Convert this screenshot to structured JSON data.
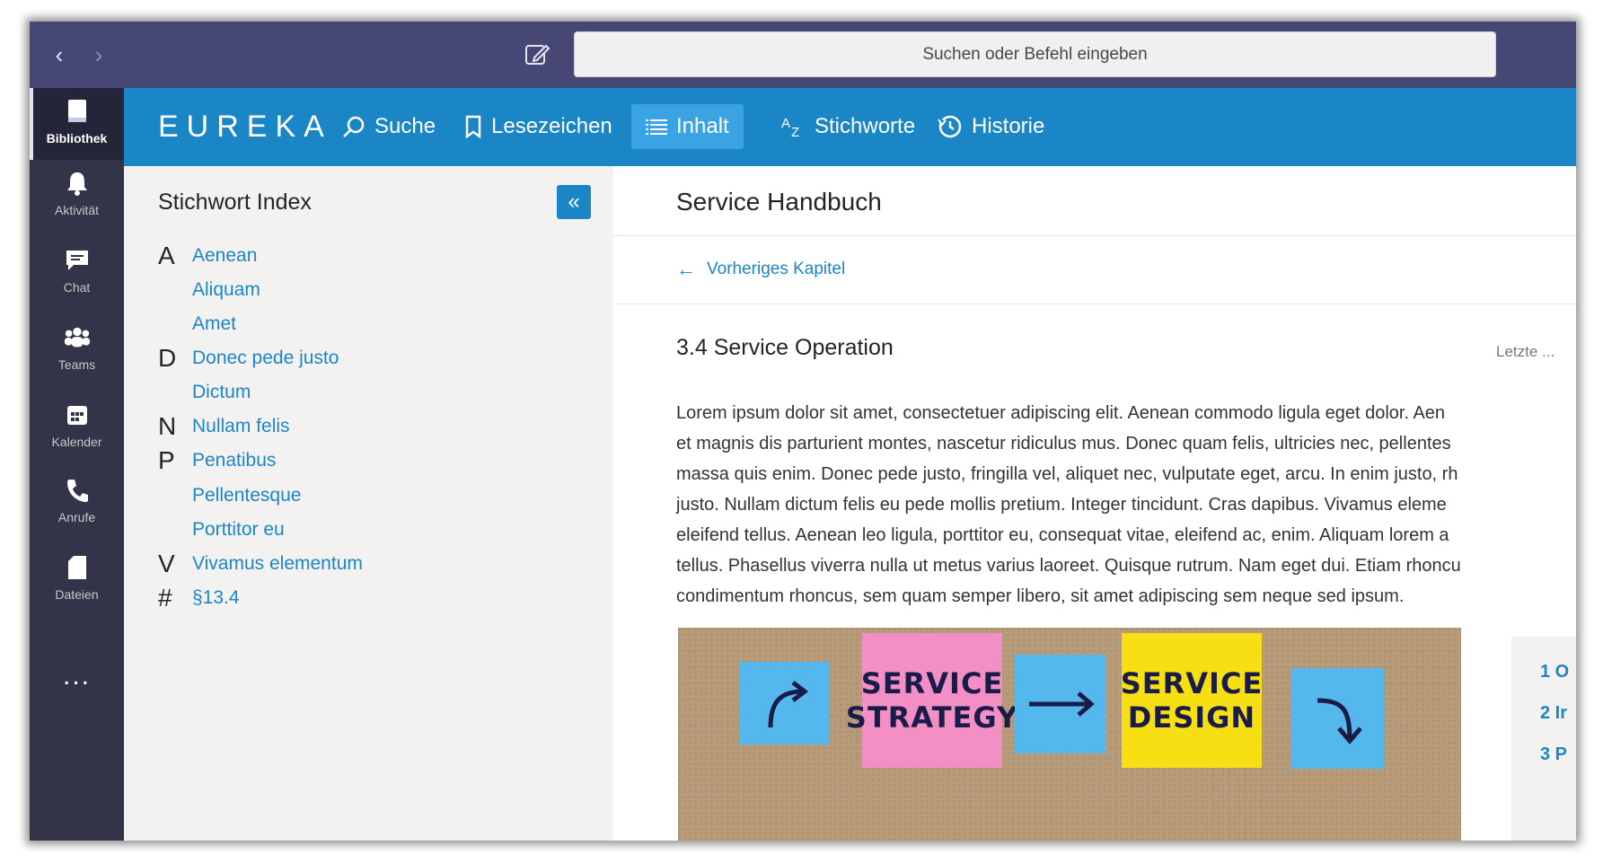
{
  "titlebar": {
    "search_placeholder": "Suchen oder Befehl eingeben"
  },
  "rail": {
    "items": [
      {
        "label": "Bibliothek",
        "icon": "library-icon",
        "active": true
      },
      {
        "label": "Aktivität",
        "icon": "bell-icon"
      },
      {
        "label": "Chat",
        "icon": "chat-icon"
      },
      {
        "label": "Teams",
        "icon": "teams-icon"
      },
      {
        "label": "Kalender",
        "icon": "calendar-icon"
      },
      {
        "label": "Anrufe",
        "icon": "phone-icon"
      },
      {
        "label": "Dateien",
        "icon": "file-icon"
      }
    ],
    "more": "..."
  },
  "appbar": {
    "logo": "EUREKA",
    "tabs": [
      {
        "label": "Suche",
        "icon": "search-icon"
      },
      {
        "label": "Lesezeichen",
        "icon": "bookmark-icon"
      },
      {
        "label": "Inhalt",
        "icon": "list-icon",
        "active": true
      },
      {
        "label": "Stichworte",
        "icon": "az-sort-icon"
      },
      {
        "label": "Historie",
        "icon": "history-icon"
      }
    ]
  },
  "index": {
    "title": "Stichwort Index",
    "collapse_symbol": "«",
    "entries": [
      {
        "letter": "A",
        "term": "Aenean"
      },
      {
        "letter": "",
        "term": "Aliquam"
      },
      {
        "letter": "",
        "term": "Amet"
      },
      {
        "letter": "D",
        "term": "Donec pede justo"
      },
      {
        "letter": "",
        "term": "Dictum"
      },
      {
        "letter": "N",
        "term": "Nullam felis"
      },
      {
        "letter": "P",
        "term": "Penatibus"
      },
      {
        "letter": "",
        "term": "Pellentesque"
      },
      {
        "letter": "",
        "term": "Porttitor eu"
      },
      {
        "letter": "V",
        "term": "Vivamus elementum"
      },
      {
        "letter": "#",
        "term": "§13.4"
      }
    ]
  },
  "content": {
    "doc_title": "Service Handbuch",
    "prev_link": "Vorheriges Kapitel",
    "section_heading": "3.4 Service Operation",
    "last_updated": "Letzte ...",
    "body_lines": [
      "Lorem ipsum dolor sit amet, consectetuer adipiscing elit. Aenean commodo ligula eget dolor. Aen",
      "et magnis dis parturient montes, nascetur ridiculus mus. Donec quam felis, ultricies nec, pellentes",
      "massa quis enim. Donec pede justo, fringilla vel, aliquet nec, vulputate eget, arcu. In enim justo, rh",
      "justo. Nullam dictum felis eu pede mollis pretium. Integer tincidunt. Cras dapibus. Vivamus eleme",
      "eleifend tellus. Aenean leo ligula, porttitor eu, consequat vitae, eleifend ac, enim. Aliquam lorem a",
      "tellus. Phasellus viverra nulla ut metus varius laoreet. Quisque rutrum. Nam eget dui. Etiam rhoncu",
      "condimentum rhoncus, sem quam semper libero, sit amet adipiscing sem neque sed ipsum."
    ],
    "image_notes": {
      "note1": "SERVICE STRATEGY",
      "note2": "SERVICE DESIGN"
    },
    "toc": [
      "1 O",
      "2 Ir",
      "3 P"
    ]
  },
  "colors": {
    "titlebar": "#464775",
    "rail": "#33344a",
    "accent": "#1b86c6",
    "active_tab": "#3aa3e4"
  }
}
